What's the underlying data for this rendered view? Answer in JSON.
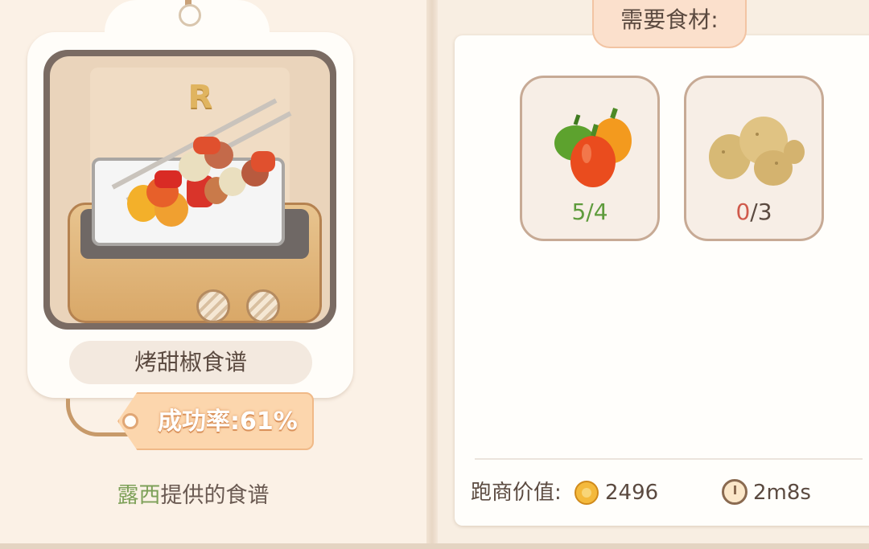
{
  "recipe": {
    "rarity": "R",
    "name": "烤甜椒食谱",
    "success_rate": "成功率:61%",
    "provider_name": "露西",
    "provider_suffix": "提供的食谱"
  },
  "ingredients_panel": {
    "title": "需要食材:",
    "items": [
      {
        "icon": "bell-pepper-icon",
        "have": "5",
        "sep_need": "/4",
        "status": "enough"
      },
      {
        "icon": "potato-icon",
        "have": "0",
        "sep_need": "/3",
        "status": "lacking"
      }
    ],
    "trade_label": "跑商价值:",
    "trade_value": "2496",
    "time": "2m8s"
  },
  "colors": {
    "enough": "#5e9b3c",
    "lacking": "#d05a4c",
    "tag": "#fcd6ad",
    "provider_name": "#7da058"
  }
}
